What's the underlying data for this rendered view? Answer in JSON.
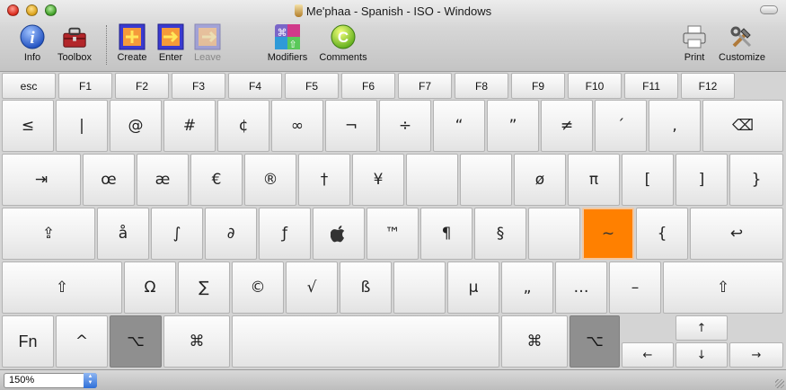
{
  "window": {
    "title": "Me'phaa - Spanish - ISO - Windows"
  },
  "toolbar": {
    "info": "Info",
    "toolbox": "Toolbox",
    "create": "Create",
    "enter": "Enter",
    "leave": "Leave",
    "modifiers": "Modifiers",
    "comments": "Comments",
    "print": "Print",
    "customize": "Customize"
  },
  "keyboard": {
    "fn_row": [
      "esc",
      "F1",
      "F2",
      "F3",
      "F4",
      "F5",
      "F6",
      "F7",
      "F8",
      "F9",
      "F10",
      "F11",
      "F12"
    ],
    "row1": [
      "≤",
      "|",
      "@",
      "#",
      "¢",
      "∞",
      "¬",
      "÷",
      "“",
      "”",
      "≠",
      "´",
      "‚",
      "⌫"
    ],
    "row2": [
      "⇥",
      "œ",
      "æ",
      "€",
      "®",
      "†",
      "¥",
      "",
      "",
      "ø",
      "π",
      "[",
      "]",
      "}"
    ],
    "row3": [
      "⇪",
      "å",
      "∫",
      "∂",
      "ƒ",
      "",
      "™",
      "¶",
      "§",
      "",
      "~",
      "{",
      "↩"
    ],
    "row4": [
      "⇧",
      "Ω",
      "∑",
      "©",
      "√",
      "ß",
      "",
      "µ",
      "„",
      "…",
      "–",
      "⇧"
    ],
    "row5": [
      "Fn",
      "^",
      "⌥",
      "⌘",
      "",
      "⌘",
      "⌥"
    ],
    "arrows": {
      "up": "↑",
      "left": "←",
      "down": "↓",
      "right": "→"
    },
    "highlighted_key_color": "#ff8000"
  },
  "statusbar": {
    "zoom": "150%"
  }
}
